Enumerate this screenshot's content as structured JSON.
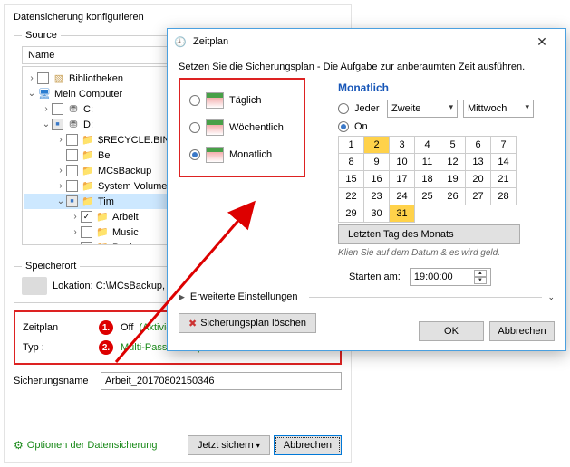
{
  "main": {
    "title": "Datensicherung konfigurieren",
    "source_legend": "Source",
    "tree_header": "Name",
    "tree": {
      "bibliotheken": "Bibliotheken",
      "mein_computer": "Mein Computer",
      "drive_c": "C:",
      "drive_d": "D:",
      "recycle": "$RECYCLE.BIN",
      "be": "Be",
      "mcsbackup": "MCsBackup",
      "svi": "System Volume Inf",
      "tim": "Tim",
      "arbeit": "Arbeit",
      "music": "Music",
      "package": "Package"
    },
    "speicherort_legend": "Speicherort",
    "lokation_label": "Lokation: C:\\MCsBackup, Spe",
    "zeitplan_label": "Zeitplan",
    "zeitplan_value": "Off",
    "zeitplan_action": "(Aktivieren)",
    "typ_label": "Typ :",
    "typ_value": "Multi-Pass Backup",
    "badge1": "1.",
    "badge2": "2.",
    "sicherungsname_label": "Sicherungsname",
    "sicherungsname_value": "Arbeit_20170802150346",
    "optionen_link": "Optionen der Datensicherung",
    "jetzt_sichern": "Jetzt sichern",
    "abbrechen": "Abbrechen"
  },
  "dialog": {
    "title": "Zeitplan",
    "instruction": "Setzen Sie die Sicherungsplan - Die Aufgabe zur anberaumten Zeit ausführen.",
    "freq": {
      "daily": "Täglich",
      "weekly": "Wöchentlich",
      "monthly": "Monatlich"
    },
    "monthly_label": "Monatlich",
    "jeder": "Jeder",
    "on": "On",
    "sel_ordinal": "Zweite",
    "sel_weekday": "Mittwoch",
    "days": [
      [
        1,
        2,
        3,
        4,
        5,
        6,
        7
      ],
      [
        8,
        9,
        10,
        11,
        12,
        13,
        14
      ],
      [
        15,
        16,
        17,
        18,
        19,
        20,
        21
      ],
      [
        22,
        23,
        24,
        25,
        26,
        27,
        28
      ],
      [
        29,
        30,
        31
      ]
    ],
    "highlighted_days": [
      2,
      31
    ],
    "last_day": "Letzten Tag des Monats",
    "hint": "Klien Sie auf dem Datum & es wird geld.",
    "start_label": "Starten am:",
    "start_time": "19:00:00",
    "advanced": "Erweiterte Einstellungen",
    "delete_plan": "Sicherungsplan löschen",
    "ok": "OK",
    "cancel": "Abbrechen"
  }
}
